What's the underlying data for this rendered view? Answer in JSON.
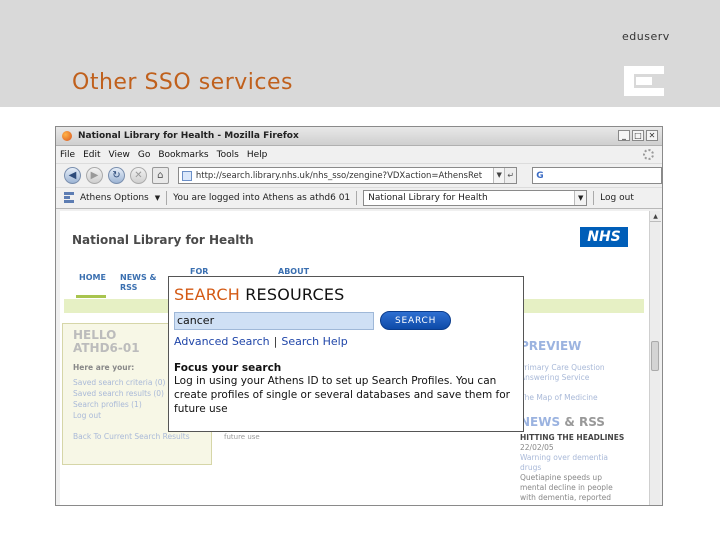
{
  "slide": {
    "title": "Other SSO services",
    "brand": "eduserv"
  },
  "browser": {
    "window_title": "National Library for Health - Mozilla Firefox",
    "menu": [
      "File",
      "Edit",
      "View",
      "Go",
      "Bookmarks",
      "Tools",
      "Help"
    ],
    "url": "http://search.library.nhs.uk/nhs_sso/zengine?VDXaction=AthensRet",
    "search_engine": "G",
    "athens_options": "Athens Options",
    "login_status": "You are logged into Athens as athd6 01",
    "selected_resource": "National Library for Health",
    "logout": "Log out"
  },
  "page": {
    "site_title": "National Library for Health",
    "logo": "NHS",
    "nav": {
      "home": "HOME",
      "news_rss": "NEWS & RSS",
      "tab3": "FOR",
      "tab4": "ABOUT"
    },
    "hello": {
      "title1": "HELLO",
      "title2": "ATHD6-01",
      "here_are": "Here are your:",
      "items": [
        "Saved search criteria (0)",
        "Saved search results (0)",
        "Search profiles (1)",
        "Log out"
      ],
      "back": "Back To Current Search Results"
    },
    "bg_fragment": "future use",
    "preview": {
      "title": "PREVIEW",
      "lines": [
        "Primary Care Question",
        "Answering Service",
        "The Map of Medicine"
      ]
    },
    "news": {
      "title_a": "NEWS",
      "title_b": "& RSS",
      "headline": "HITTING THE HEADLINES",
      "date": "22/02/05",
      "item1a": "Warning over dementia",
      "item1b": "drugs",
      "item2a": "Quetiapine speeds up",
      "item2b": "mental decline in people",
      "item2c": "with dementia, reported"
    }
  },
  "search_popup": {
    "title_a": "SEARCH",
    "title_b": "RESOURCES",
    "query": "cancer",
    "button": "SEARCH",
    "advanced": "Advanced Search",
    "separator": "|",
    "help": "Search Help",
    "focus_title": "Focus your search",
    "focus_text": "Log in using your Athens ID to set up Search Profiles. You can create profiles of single or several databases and save them for future use"
  }
}
